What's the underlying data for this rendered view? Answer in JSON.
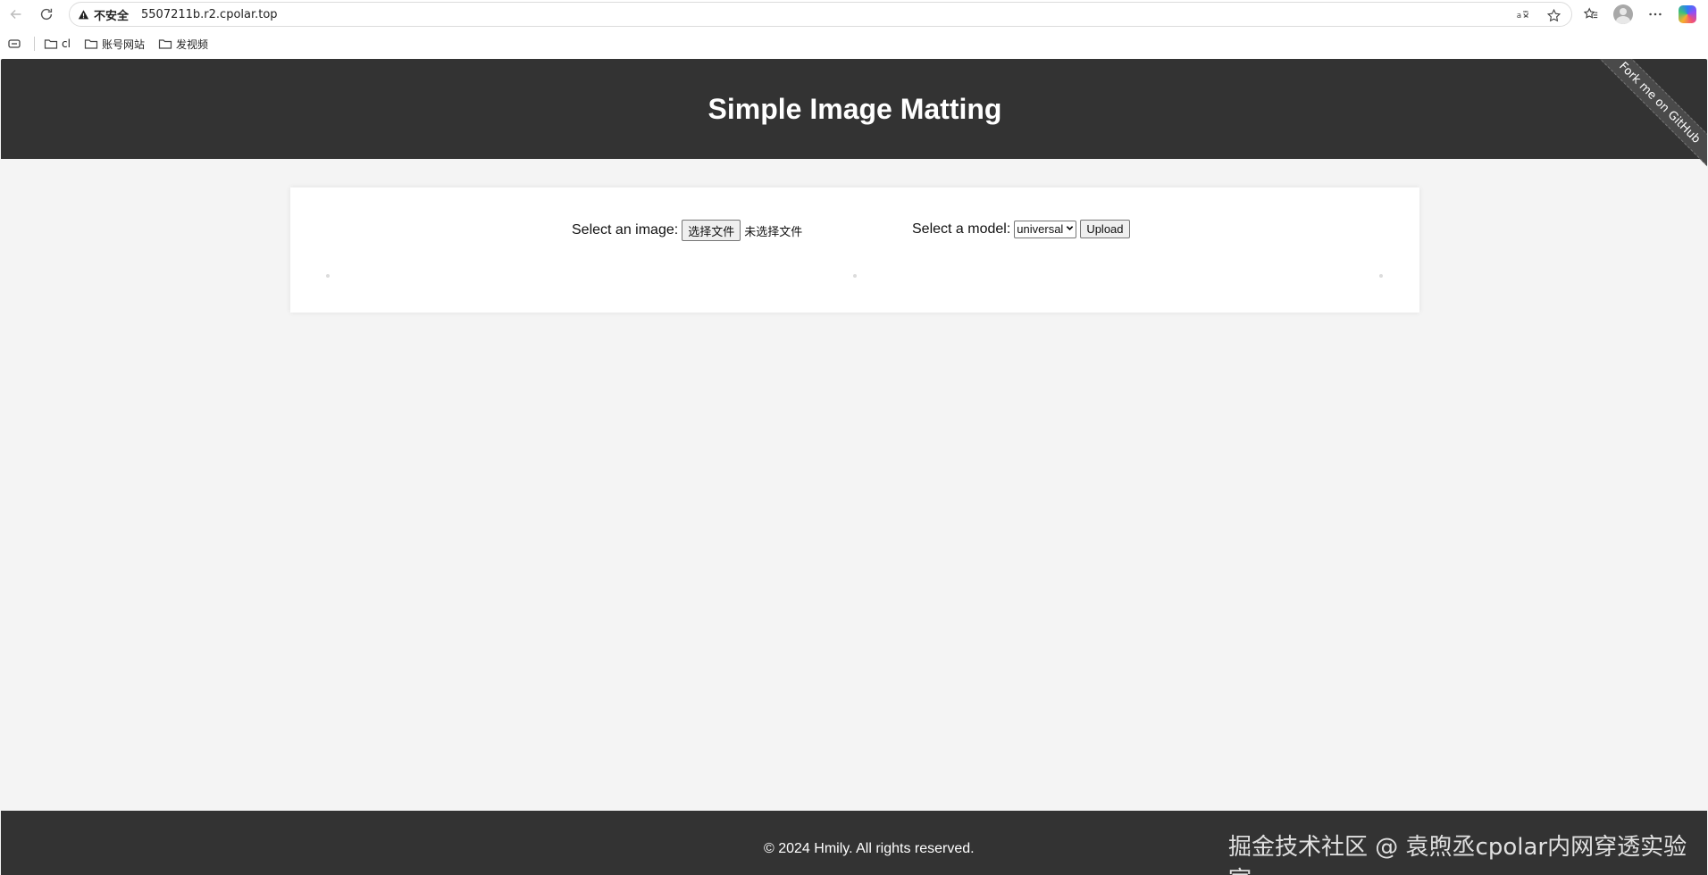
{
  "browser": {
    "security_label": "不安全",
    "url": "5507211b.r2.cpolar.top",
    "bookmarks": [
      {
        "label": "cl"
      },
      {
        "label": "账号网站"
      },
      {
        "label": "发视频"
      }
    ]
  },
  "header": {
    "title": "Simple Image Matting",
    "ribbon": "Fork me on GitHub"
  },
  "form": {
    "image_label": "Select an image:",
    "file_button": "选择文件",
    "file_status": "未选择文件",
    "model_label": "Select a model:",
    "model_selected": "universal",
    "upload_button": "Upload"
  },
  "footer": {
    "copyright": "© 2024 Hmily. All rights reserved.",
    "watermark": "掘金技术社区 @ 袁煦丞cpolar内网穿透实验室"
  }
}
